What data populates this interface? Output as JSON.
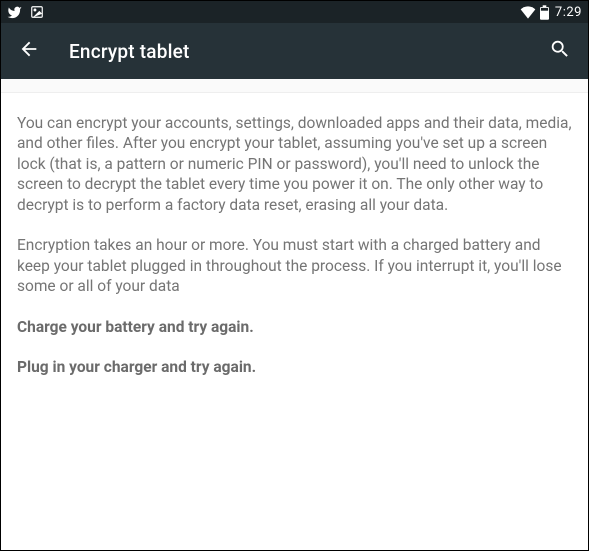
{
  "status_bar": {
    "clock": "7:29"
  },
  "app_bar": {
    "title": "Encrypt tablet"
  },
  "content": {
    "para1": "You can encrypt your accounts, settings, downloaded apps and their data, media, and other files. After you encrypt your tablet, assuming you've set up a screen lock (that is, a pattern or numeric PIN or password), you'll need to unlock the screen to decrypt the tablet every time you power it on. The only other way to decrypt is to perform a factory data reset, erasing all your data.",
    "para2": "Encryption takes an hour or more. You must start with a charged battery and keep your tablet plugged in throughout the process. If you interrupt it, you'll lose some or all of your data",
    "msg_battery": "Charge your battery and try again.",
    "msg_charger": "Plug in your charger and try again."
  }
}
